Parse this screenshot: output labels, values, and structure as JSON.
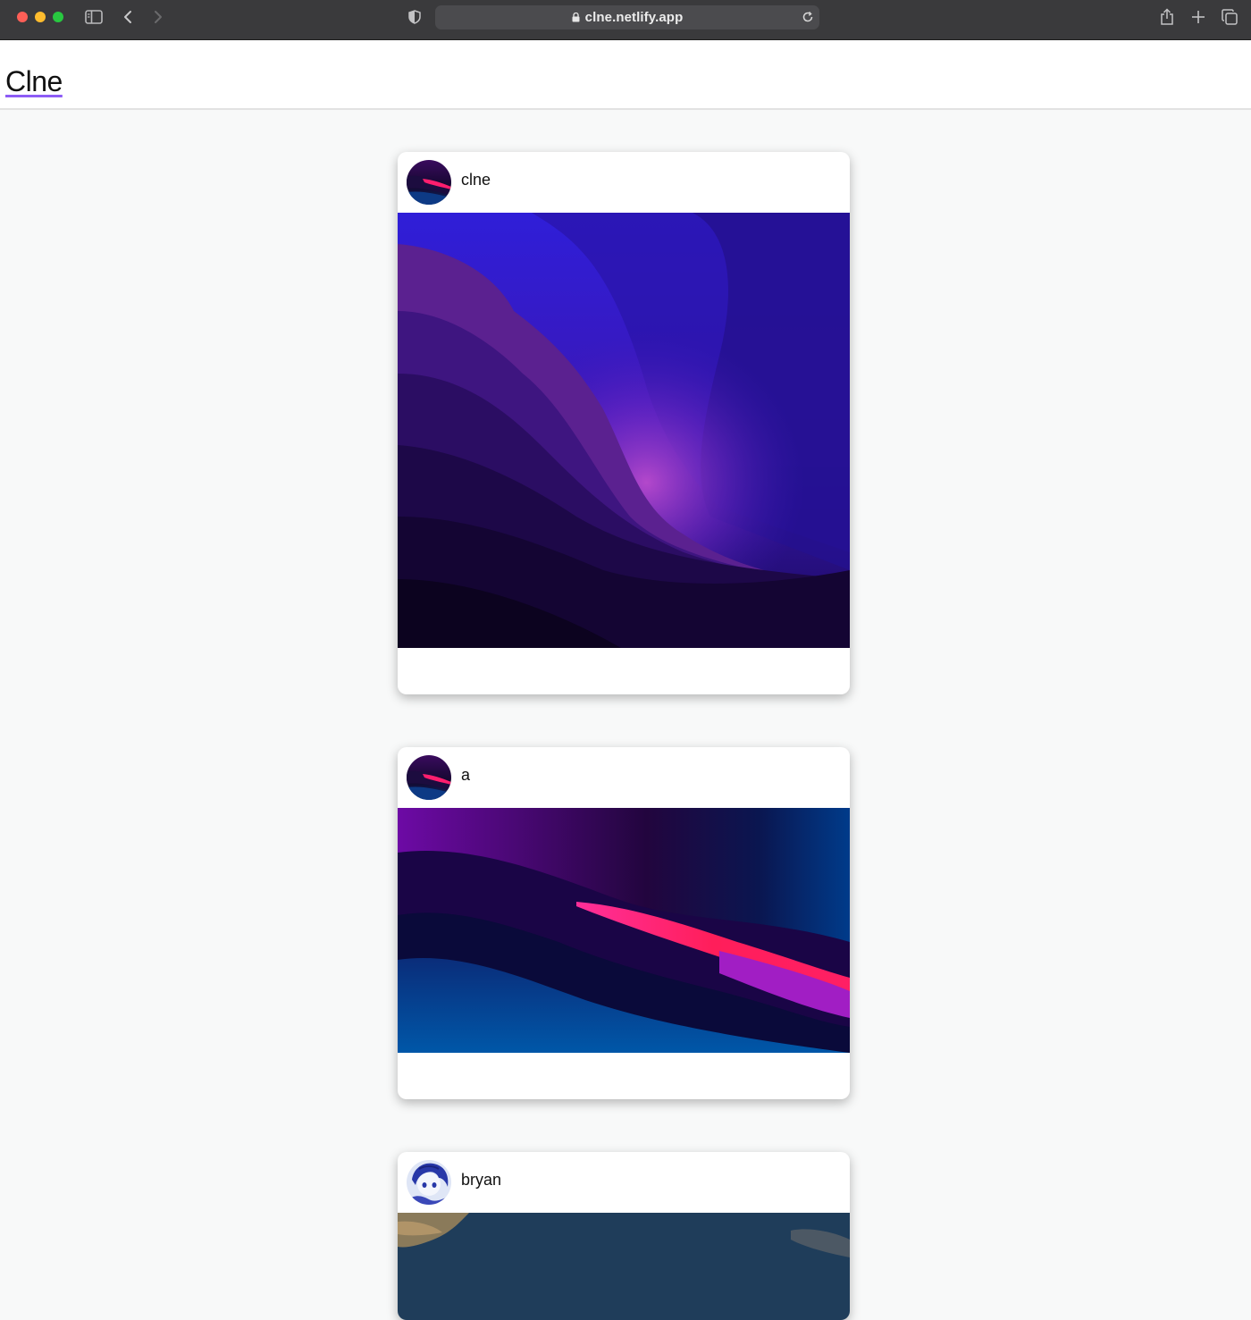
{
  "browser": {
    "url": "clne.netlify.app",
    "icons": [
      "sidebar-icon",
      "back-icon",
      "forward-icon",
      "shield-icon",
      "lock-icon",
      "reload-icon",
      "share-icon",
      "new-tab-icon",
      "tab-overview-icon"
    ]
  },
  "app": {
    "logo": "Clne"
  },
  "posts": [
    {
      "username": "clne",
      "image": "purple-mountain-landscape"
    },
    {
      "username": "a",
      "image": "purple-blue-pink-waves"
    },
    {
      "username": "bryan",
      "image": "sky-clouds-partial"
    }
  ],
  "colors": {
    "page_bg": "#f8f9f9",
    "logo_underline": "#8d5cf6"
  }
}
